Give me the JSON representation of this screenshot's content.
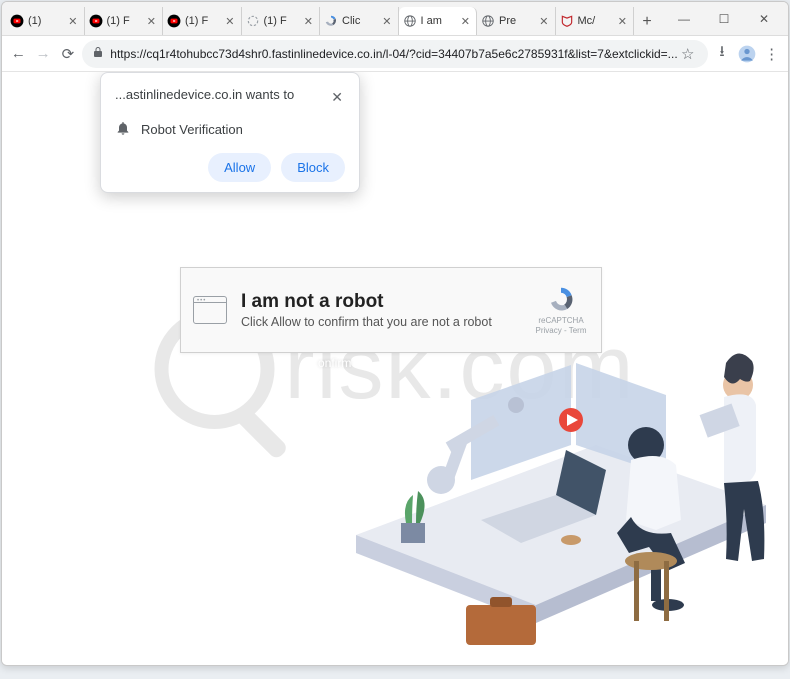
{
  "window": {
    "minimize": "—",
    "maximize": "☐",
    "close": "✕"
  },
  "tabs": [
    {
      "title": "(1)",
      "favicon": "youtube"
    },
    {
      "title": "(1) F",
      "favicon": "youtube"
    },
    {
      "title": "(1) F",
      "favicon": "youtube"
    },
    {
      "title": "(1) F",
      "favicon": "spinner"
    },
    {
      "title": "Clic",
      "favicon": "recaptcha"
    },
    {
      "title": "I am",
      "favicon": "globe",
      "active": true
    },
    {
      "title": "Pre",
      "favicon": "globe"
    },
    {
      "title": "Mc/",
      "favicon": "mcafee"
    }
  ],
  "newtab": "+",
  "toolbar": {
    "back": "←",
    "forward": "→",
    "reload": "⟳",
    "url": "https://cq1r4tohubcc73d4shr0.fastinlinedevice.co.in/l-04/?cid=34407b7a5e6c2785931f&list=7&extclickid=...",
    "star": "☆",
    "download": "⭳",
    "profile": "●",
    "menu": "⋮"
  },
  "permission": {
    "origin": "...astinlinedevice.co.in wants to",
    "label": "Robot Verification",
    "allow": "Allow",
    "block": "Block",
    "close": "✕"
  },
  "captcha": {
    "title": "I am not a robot",
    "subtitle": "Click Allow to confirm that you are not a robot",
    "brand": "reCAPTCHA",
    "links": "Privacy - Term"
  },
  "overlay_text": "onfirm",
  "watermark": "risk.com"
}
